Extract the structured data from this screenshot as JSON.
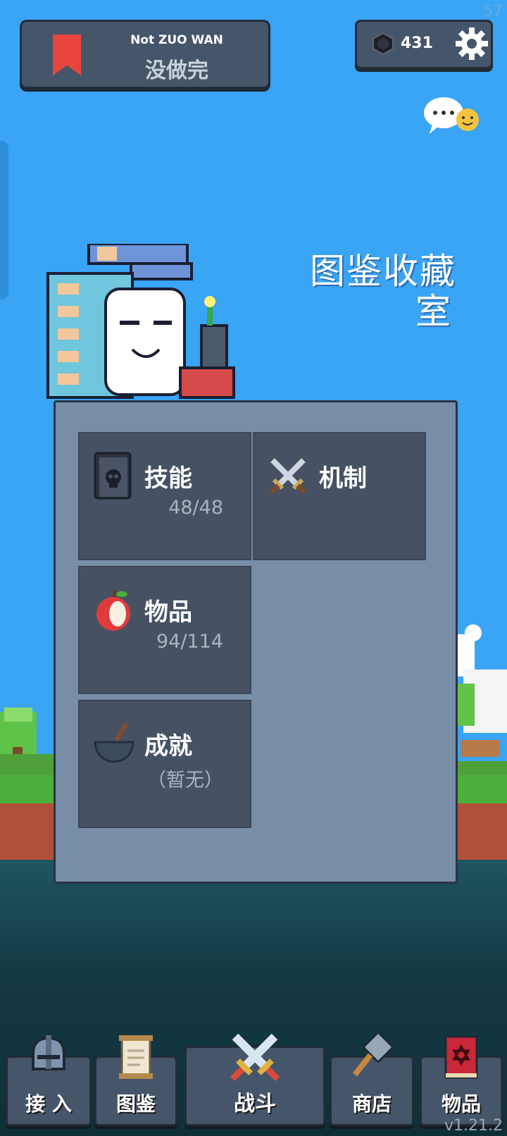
{
  "fps": "57",
  "title": {
    "subtitle": "Not ZUO WAN",
    "main": "没做完"
  },
  "currency": {
    "gems": "431"
  },
  "room": {
    "title_line1": "图鉴收藏",
    "title_line2": "室"
  },
  "tiles": {
    "skills": {
      "label": "技能",
      "count": "48/48"
    },
    "mechanics": {
      "label": "机制"
    },
    "items": {
      "label": "物品",
      "count": "94/114"
    },
    "achievements": {
      "label": "成就",
      "count": "（暂无）"
    }
  },
  "nav": {
    "join": "接 入",
    "codex": "图鉴",
    "battle": "战斗",
    "shop": "商店",
    "items": "物品"
  },
  "version": "v1.21.2",
  "colors": {
    "sky": "#3aa4f5",
    "panel": "#788da6",
    "tile": "#465264",
    "nav": "#46566a",
    "bookmark": "#e8453c"
  },
  "icons": [
    "bookmark-icon",
    "gem-icon",
    "gear-icon",
    "chat-icon",
    "skull-book-icon",
    "crossed-swords-icon",
    "apple-icon",
    "bowl-icon",
    "helmet-icon",
    "scroll-icon",
    "hammer-icon",
    "red-book-icon"
  ]
}
